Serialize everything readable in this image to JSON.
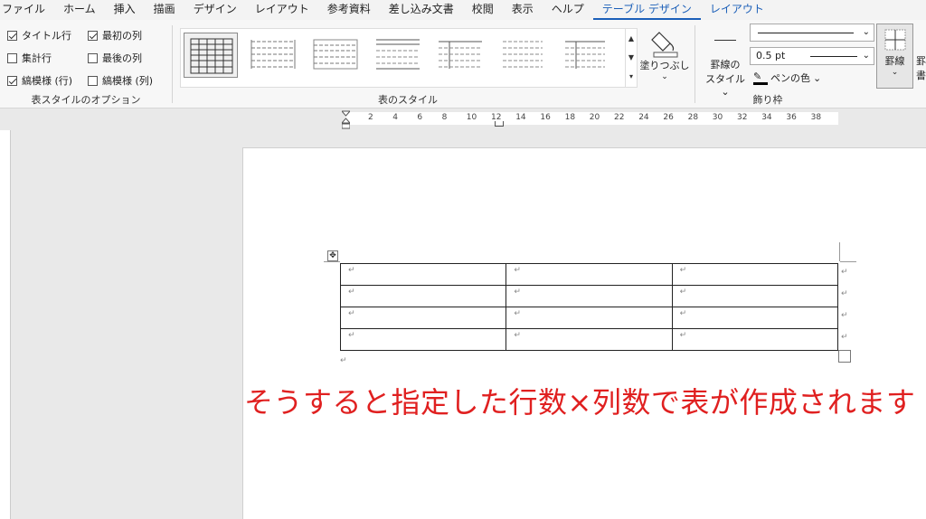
{
  "menu": {
    "tabs": [
      "ファイル",
      "ホーム",
      "挿入",
      "描画",
      "デザイン",
      "レイアウト",
      "参考資料",
      "差し込み文書",
      "校閲",
      "表示",
      "ヘルプ",
      "テーブル デザイン",
      "レイアウト"
    ],
    "active_index": 11
  },
  "style_options": {
    "label": "表スタイルのオプション",
    "title_row": {
      "label": "タイトル行",
      "checked": true
    },
    "first_col": {
      "label": "最初の列",
      "checked": true
    },
    "total_row": {
      "label": "集計行",
      "checked": false
    },
    "last_col": {
      "label": "最後の列",
      "checked": false
    },
    "banded_rows": {
      "label": "縞模様 (行)",
      "checked": true
    },
    "banded_cols": {
      "label": "縞模様 (列)",
      "checked": false
    }
  },
  "table_styles": {
    "label": "表のスタイル"
  },
  "shading": {
    "label": "塗りつぶし"
  },
  "borders": {
    "label": "飾り枠",
    "border_style_label_1": "罫線の",
    "border_style_label_2": "スタイル",
    "width_value": "0.5 pt",
    "pen_color_label": "ペンの色",
    "borders_button_label": "罫線",
    "painter_label_partial": "罫\n書"
  },
  "ruler": {
    "ticks": [
      "2",
      "4",
      "6",
      "8",
      "10",
      "12",
      "14",
      "16",
      "18",
      "20",
      "22",
      "24",
      "26",
      "28",
      "30",
      "32",
      "34",
      "36",
      "38"
    ]
  },
  "document": {
    "table": {
      "rows": 4,
      "cols": 3,
      "cell_mark": "↵"
    },
    "caption": "そうすると指定した行数×列数で表が作成されます"
  },
  "colors": {
    "accent": "#1b5fb8",
    "caption": "#e02020"
  }
}
